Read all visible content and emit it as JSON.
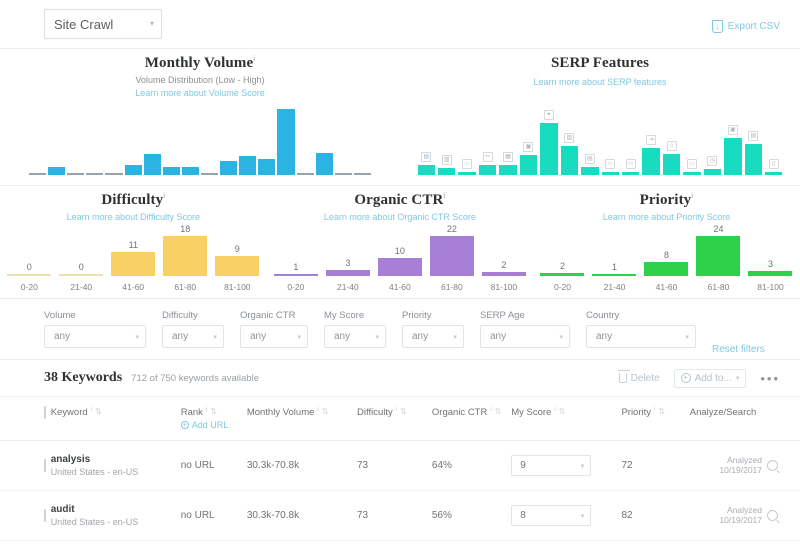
{
  "topbar": {
    "crawl_select_value": "Site Crawl",
    "caret": "▾",
    "export_label": "Export CSV",
    "export_icon": "download-icon"
  },
  "volume_panel": {
    "title": "Monthly Volume",
    "info_mark": "i",
    "subtitle": "Volume Distribution (Low - High)",
    "link": "Learn more about Volume Score"
  },
  "serp_panel": {
    "title": "SERP Features",
    "link": "Learn more about SERP features"
  },
  "histograms": [
    {
      "title": "Difficulty",
      "link": "Learn more about Difficulty Score",
      "color": "#f8cf64"
    },
    {
      "title": "Organic CTR",
      "link": "Learn more about Organic CTR Score",
      "color": "#a87fd6"
    },
    {
      "title": "Priority",
      "link": "Learn more about Priority Score",
      "color": "#2fd04a"
    }
  ],
  "filters": {
    "items": [
      {
        "label": "Volume",
        "value": "any"
      },
      {
        "label": "Difficulty",
        "value": "any"
      },
      {
        "label": "Organic CTR",
        "value": "any"
      },
      {
        "label": "My Score",
        "value": "any"
      },
      {
        "label": "Priority",
        "value": "any"
      },
      {
        "label": "SERP Age",
        "value": "any"
      },
      {
        "label": "Country",
        "value": "any"
      }
    ],
    "reset_label": "Reset filters",
    "caret": "▾"
  },
  "keywords_bar": {
    "count_label": "38 Keywords",
    "available_label": "712 of 750 keywords available",
    "delete_label": "Delete",
    "add_to_label": "Add to...",
    "add_to_caret": "▾",
    "more_label": "•••"
  },
  "table": {
    "headers": [
      {
        "label": "Keyword",
        "info": "i",
        "sort": "⇅"
      },
      {
        "label": "Rank",
        "info": "i",
        "sort": "⇅",
        "sub": "Add URL"
      },
      {
        "label": "Monthly Volume",
        "info": "i",
        "sort": "⇅"
      },
      {
        "label": "Difficulty",
        "info": "i",
        "sort": "⇅"
      },
      {
        "label": "Organic CTR",
        "info": "i",
        "sort": "⇅"
      },
      {
        "label": "My Score",
        "info": "i",
        "sort": "⇅"
      },
      {
        "label": "Priority",
        "info": "i",
        "sort": "⇅"
      },
      {
        "label": "Analyze/Search",
        "info": "",
        "sort": ""
      }
    ],
    "rows": [
      {
        "keyword": "analysis",
        "location": "United States - en-US",
        "rank": "no URL",
        "monthly_volume": "30.3k-70.8k",
        "difficulty": "73",
        "organic_ctr": "64%",
        "my_score": "9",
        "priority": "72",
        "analyzed_label": "Analyzed",
        "analyzed_date": "10/19/2017"
      },
      {
        "keyword": "audit",
        "location": "United States - en-US",
        "rank": "no URL",
        "monthly_volume": "30.3k-70.8k",
        "difficulty": "73",
        "organic_ctr": "56%",
        "my_score": "8",
        "priority": "82",
        "analyzed_label": "Analyzed",
        "analyzed_date": "10/19/2017"
      }
    ]
  },
  "chart_data": [
    {
      "type": "bar",
      "title": "Monthly Volume",
      "subtitle": "Volume Distribution (Low - High)",
      "xlabel": "",
      "ylabel": "",
      "color": "#2bb3e3",
      "categories": [
        "1",
        "2",
        "3",
        "4",
        "5",
        "6",
        "7",
        "8",
        "9",
        "10",
        "11",
        "12",
        "13",
        "14",
        "15",
        "16",
        "17",
        "18"
      ],
      "values": [
        1,
        5,
        1,
        1,
        1,
        6,
        13,
        5,
        5,
        1,
        9,
        12,
        10,
        41,
        1,
        14,
        1,
        1
      ],
      "values_extra": [
        4
      ],
      "ylim": [
        0,
        45
      ],
      "grid": false,
      "legend": "none"
    },
    {
      "type": "bar",
      "title": "SERP Features",
      "xlabel": "",
      "ylabel": "",
      "color": "#18dcc0",
      "categories": [
        "featured-snippet",
        "reviews",
        "image-pack",
        "news",
        "site-links",
        "video",
        "shopping",
        "knowledge-panel",
        "local-pack",
        "tweets",
        "local-teaser",
        "app-pack",
        "ad-top",
        "ad-bottom",
        "related-questions",
        "carousel",
        "hotel-pack",
        "jobs"
      ],
      "values": [
        9,
        6,
        3,
        9,
        9,
        17,
        45,
        25,
        7,
        3,
        3,
        23,
        18,
        3,
        5,
        32,
        27,
        2
      ],
      "ylim": [
        0,
        50
      ],
      "grid": false,
      "legend": "none"
    },
    {
      "type": "bar",
      "title": "Difficulty",
      "xlabel": "",
      "ylabel": "",
      "color": "#f8cf64",
      "categories": [
        "0-20",
        "21-40",
        "41-60",
        "61-80",
        "81-100"
      ],
      "values": [
        0,
        0,
        11,
        18,
        9
      ],
      "ylim": [
        0,
        20
      ],
      "grid": false,
      "legend": "none"
    },
    {
      "type": "bar",
      "title": "Organic CTR",
      "xlabel": "",
      "ylabel": "",
      "color": "#a87fd6",
      "categories": [
        "0-20",
        "21-40",
        "41-60",
        "61-80",
        "81-100"
      ],
      "values": [
        1,
        3,
        10,
        22,
        2
      ],
      "ylim": [
        0,
        24
      ],
      "grid": false,
      "legend": "none"
    },
    {
      "type": "bar",
      "title": "Priority",
      "xlabel": "",
      "ylabel": "",
      "color": "#2fd04a",
      "categories": [
        "0-20",
        "21-40",
        "41-60",
        "61-80",
        "81-100"
      ],
      "values": [
        2,
        1,
        8,
        24,
        3
      ],
      "ylim": [
        0,
        26
      ],
      "grid": false,
      "legend": "none"
    }
  ],
  "serp_icons": [
    "▤",
    "▥",
    "▭",
    "✂",
    "▦",
    "▣",
    "✦",
    "▨",
    "▤",
    "▭",
    "▭",
    "⇥",
    "☆",
    "▭",
    "◷",
    "▣",
    "▤",
    "▯"
  ]
}
